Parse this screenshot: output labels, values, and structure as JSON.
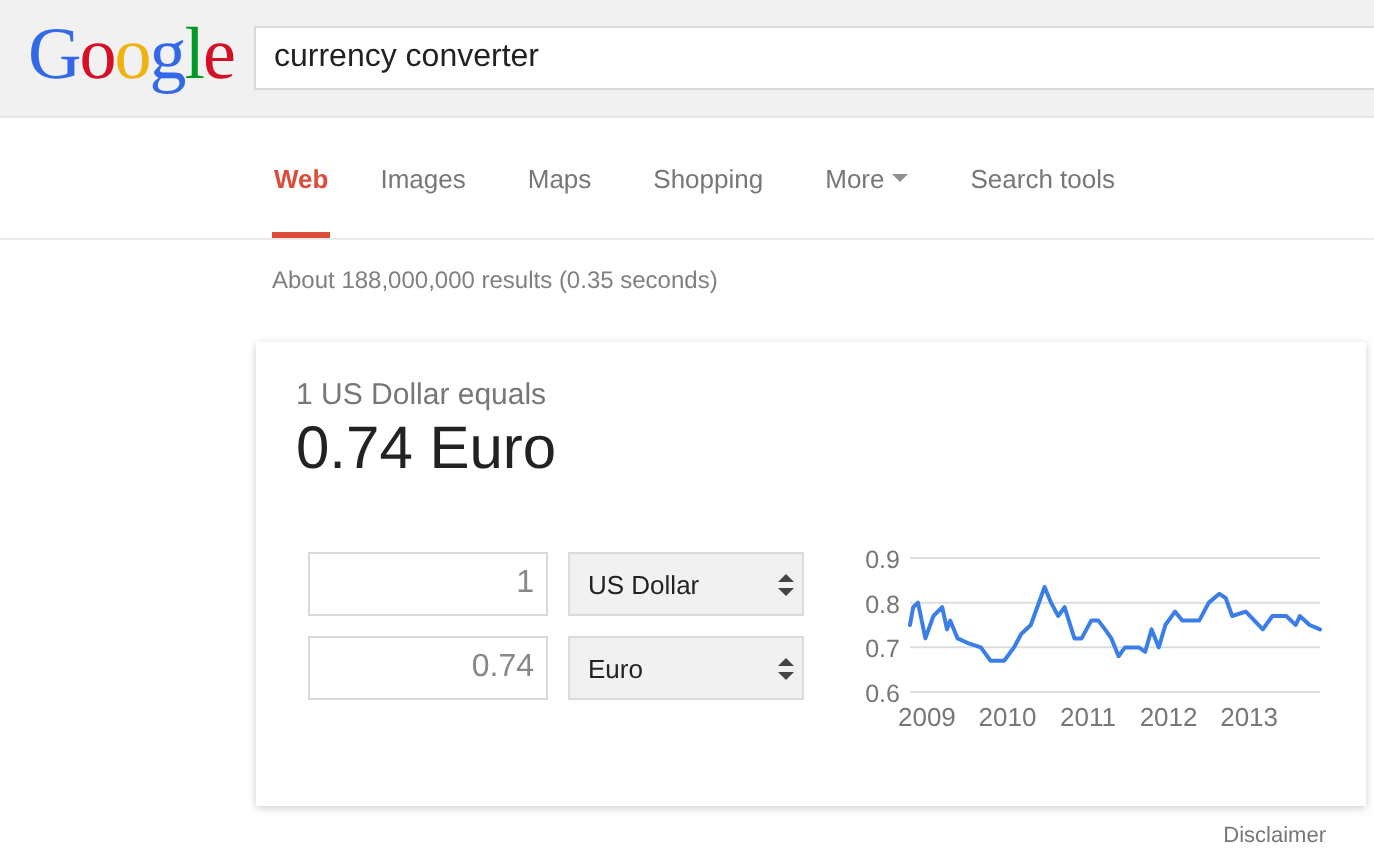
{
  "logo": "Google",
  "search": {
    "value": "currency converter"
  },
  "tabs": [
    {
      "label": "Web",
      "selected": true,
      "dropdown": false
    },
    {
      "label": "Images",
      "selected": false,
      "dropdown": false
    },
    {
      "label": "Maps",
      "selected": false,
      "dropdown": false
    },
    {
      "label": "Shopping",
      "selected": false,
      "dropdown": false
    },
    {
      "label": "More",
      "selected": false,
      "dropdown": true
    },
    {
      "label": "Search tools",
      "selected": false,
      "dropdown": false
    }
  ],
  "result_stats": "About 188,000,000 results (0.35 seconds)",
  "converter": {
    "caption": "1 US Dollar equals",
    "result": "0.74 Euro",
    "rows": [
      {
        "amount": "1",
        "currency": "US Dollar"
      },
      {
        "amount": "0.74",
        "currency": "Euro"
      }
    ],
    "chart_data": {
      "type": "line",
      "xlim": [
        2008.79,
        2013.88
      ],
      "ylim": [
        0.6,
        0.9
      ],
      "xticks": [
        2009,
        2010,
        2011,
        2012,
        2013
      ],
      "yticks": [
        {
          "value": 0.6,
          "label": "0.6"
        },
        {
          "value": 0.7,
          "label": "0.7"
        },
        {
          "value": 0.8,
          "label": "0.8"
        },
        {
          "value": 0.9,
          "label": "0.9"
        }
      ],
      "x": [
        2008.79,
        2008.83,
        2008.89,
        2008.98,
        2009.08,
        2009.19,
        2009.25,
        2009.29,
        2009.38,
        2009.5,
        2009.67,
        2009.79,
        2009.96,
        2010.08,
        2010.17,
        2010.29,
        2010.46,
        2010.54,
        2010.63,
        2010.71,
        2010.83,
        2010.92,
        2011.04,
        2011.13,
        2011.21,
        2011.29,
        2011.38,
        2011.46,
        2011.63,
        2011.71,
        2011.79,
        2011.88,
        2011.96,
        2012.08,
        2012.17,
        2012.38,
        2012.5,
        2012.63,
        2012.71,
        2012.79,
        2012.96,
        2013.17,
        2013.29,
        2013.46,
        2013.58,
        2013.63,
        2013.75,
        2013.88
      ],
      "series": [
        {
          "color": "#3b7ee8",
          "values": [
            0.75,
            0.79,
            0.8,
            0.72,
            0.77,
            0.79,
            0.74,
            0.76,
            0.72,
            0.71,
            0.7,
            0.67,
            0.67,
            0.7,
            0.73,
            0.75,
            0.835,
            0.8,
            0.77,
            0.79,
            0.72,
            0.72,
            0.76,
            0.76,
            0.74,
            0.72,
            0.68,
            0.7,
            0.7,
            0.69,
            0.74,
            0.7,
            0.75,
            0.78,
            0.76,
            0.76,
            0.8,
            0.82,
            0.81,
            0.77,
            0.78,
            0.74,
            0.77,
            0.77,
            0.75,
            0.77,
            0.75,
            0.74
          ]
        }
      ]
    }
  },
  "disclaimer": "Disclaimer"
}
